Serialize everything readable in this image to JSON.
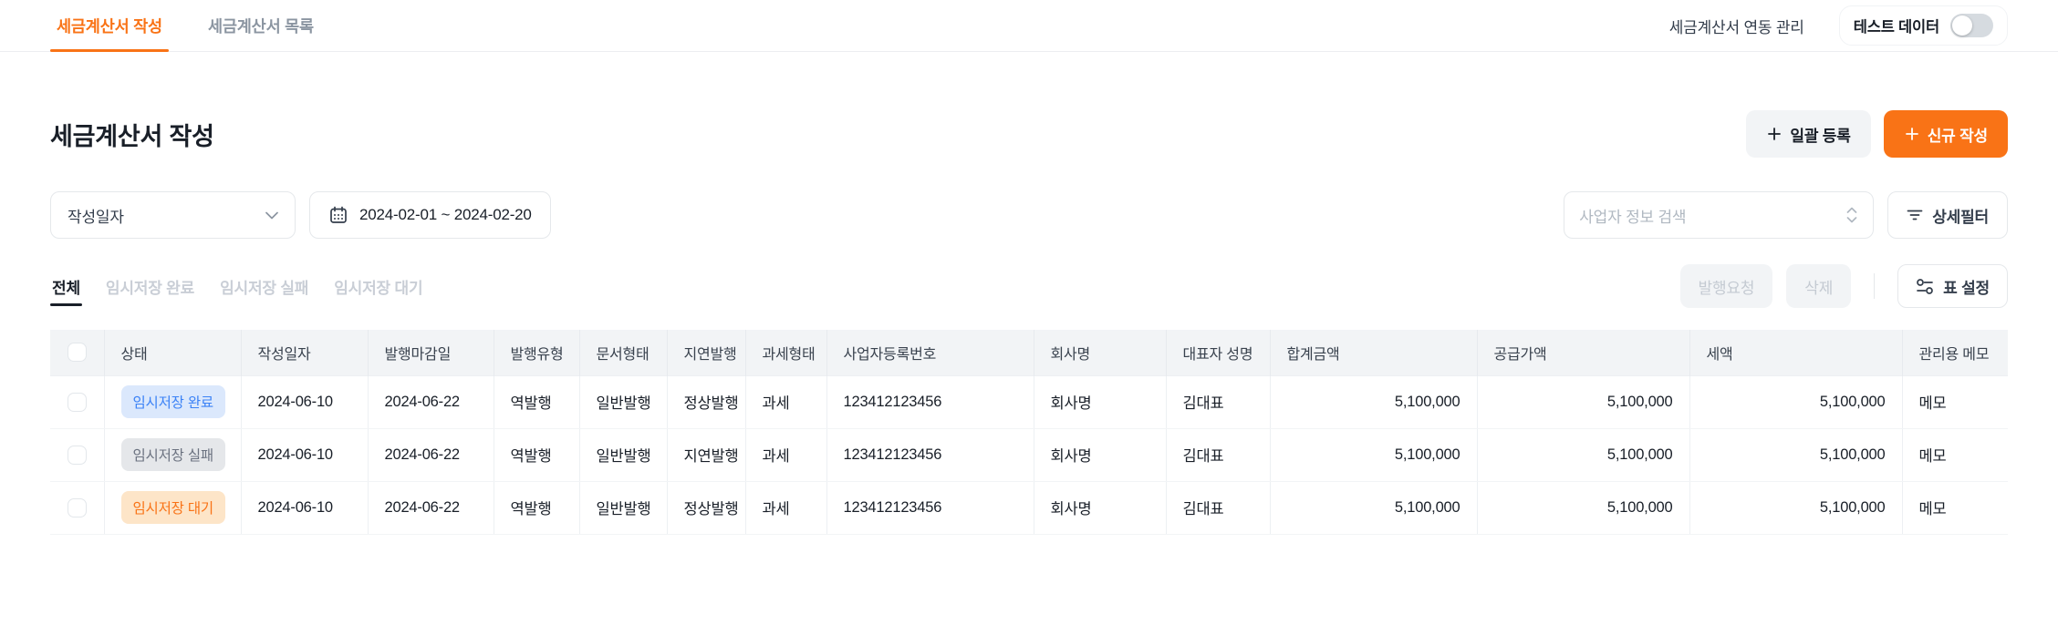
{
  "colors": {
    "accent_orange": "#f97316",
    "status_saved_blue_text": "#3b82f6",
    "status_saved_blue_bg": "#dbe8fc",
    "status_failed_gray_text": "#6b7280",
    "status_failed_gray_bg": "#e5e7ea",
    "status_waiting_orange_text": "#f97316",
    "status_waiting_orange_bg": "#fde5c8",
    "table_header_bg": "#f2f4f6"
  },
  "top_nav": {
    "tabs": [
      {
        "label": "세금계산서 작성",
        "active": true
      },
      {
        "label": "세금계산서 목록",
        "active": false
      }
    ],
    "link_label": "세금계산서 연동 관리",
    "test_data": {
      "label": "테스트 데이터",
      "enabled": false
    }
  },
  "page": {
    "title": "세금계산서 작성",
    "bulk_register_label": "일괄 등록",
    "new_create_label": "신규 작성"
  },
  "filters": {
    "date_type_value": "작성일자",
    "date_range_value": "2024-02-01 ~ 2024-02-20",
    "search_placeholder": "사업자 정보 검색",
    "detail_filter_label": "상세필터"
  },
  "status_tabs": {
    "all": "전체",
    "saved": "임시저장 완료",
    "failed": "임시저장 실패",
    "waiting": "임시저장 대기"
  },
  "actions": {
    "issue_request_label": "발행요청",
    "delete_label": "삭제",
    "table_settings_label": "표 설정"
  },
  "table": {
    "headers": [
      "상태",
      "작성일자",
      "발행마감일",
      "발행유형",
      "문서형태",
      "지연발행",
      "과세형태",
      "사업자등록번호",
      "회사명",
      "대표자 성명",
      "합계금액",
      "공급가액",
      "세액",
      "관리용 메모"
    ],
    "rows": [
      {
        "status": "임시저장 완료",
        "created": "2024-06-10",
        "deadline": "2024-06-22",
        "issue_type": "역발행",
        "doc_type": "일반발행",
        "delay": "정상발행",
        "tax_type": "과세",
        "biz_no": "123412123456",
        "company": "회사명",
        "ceo": "김대표",
        "total": "5,100,000",
        "supply": "5,100,000",
        "tax": "5,100,000",
        "memo": "메모"
      },
      {
        "status": "임시저장 실패",
        "created": "2024-06-10",
        "deadline": "2024-06-22",
        "issue_type": "역발행",
        "doc_type": "일반발행",
        "delay": "지연발행",
        "tax_type": "과세",
        "biz_no": "123412123456",
        "company": "회사명",
        "ceo": "김대표",
        "total": "5,100,000",
        "supply": "5,100,000",
        "tax": "5,100,000",
        "memo": "메모"
      },
      {
        "status": "임시저장 대기",
        "created": "2024-06-10",
        "deadline": "2024-06-22",
        "issue_type": "역발행",
        "doc_type": "일반발행",
        "delay": "정상발행",
        "tax_type": "과세",
        "biz_no": "123412123456",
        "company": "회사명",
        "ceo": "김대표",
        "total": "5,100,000",
        "supply": "5,100,000",
        "tax": "5,100,000",
        "memo": "메모"
      }
    ]
  }
}
